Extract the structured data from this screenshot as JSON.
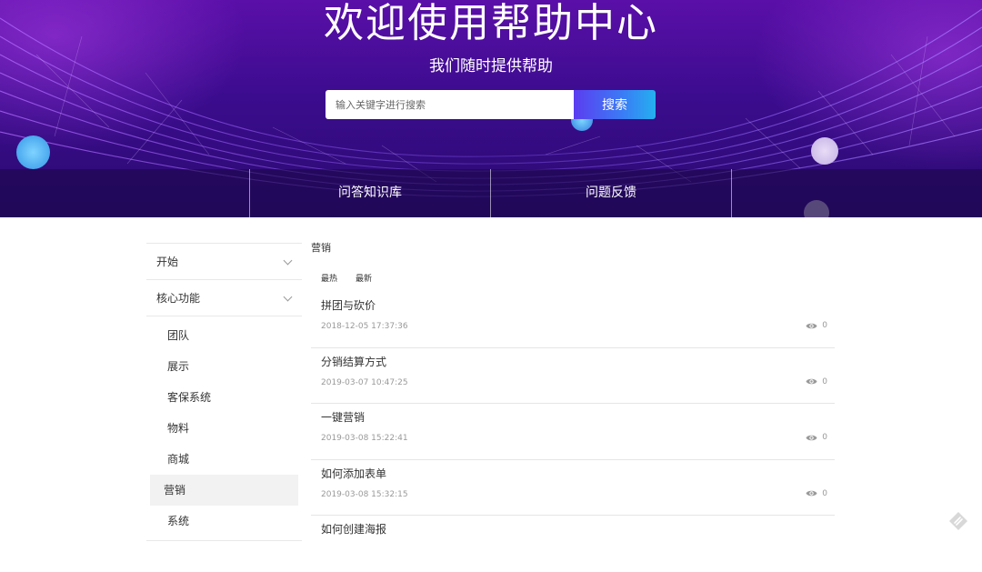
{
  "hero": {
    "title": "欢迎使用帮助中心",
    "subtitle": "我们随时提供帮助",
    "search_placeholder": "输入关键字进行搜索",
    "search_button": "搜索",
    "nav": [
      "问答知识库",
      "问题反馈"
    ]
  },
  "sidebar": {
    "groups": [
      {
        "label": "开始",
        "icon": "chevron-down-icon"
      },
      {
        "label": "核心功能",
        "icon": "chevron-down-icon"
      }
    ],
    "items": [
      "团队",
      "展示",
      "客保系统",
      "物料",
      "商城",
      "营销",
      "系统"
    ],
    "active_item": "营销"
  },
  "main": {
    "section_title": "营销",
    "sort_tabs": [
      "最热",
      "最新"
    ],
    "articles": [
      {
        "title": "拼团与砍价",
        "date": "2018-12-05 17:37:36",
        "views": "0"
      },
      {
        "title": "分销结算方式",
        "date": "2019-03-07 10:47:25",
        "views": "0"
      },
      {
        "title": "一键营销",
        "date": "2019-03-08 15:22:41",
        "views": "0"
      },
      {
        "title": "如何添加表单",
        "date": "2019-03-08 15:32:15",
        "views": "0"
      },
      {
        "title": "如何创建海报",
        "date": "",
        "views": ""
      }
    ]
  },
  "colors": {
    "hero_top": "#5a0fa8",
    "hero_bottom": "#2a0a6e",
    "search_button_start": "#5b3df0",
    "search_button_end": "#24b0f0",
    "active_item_bg": "#f2f2f2"
  }
}
